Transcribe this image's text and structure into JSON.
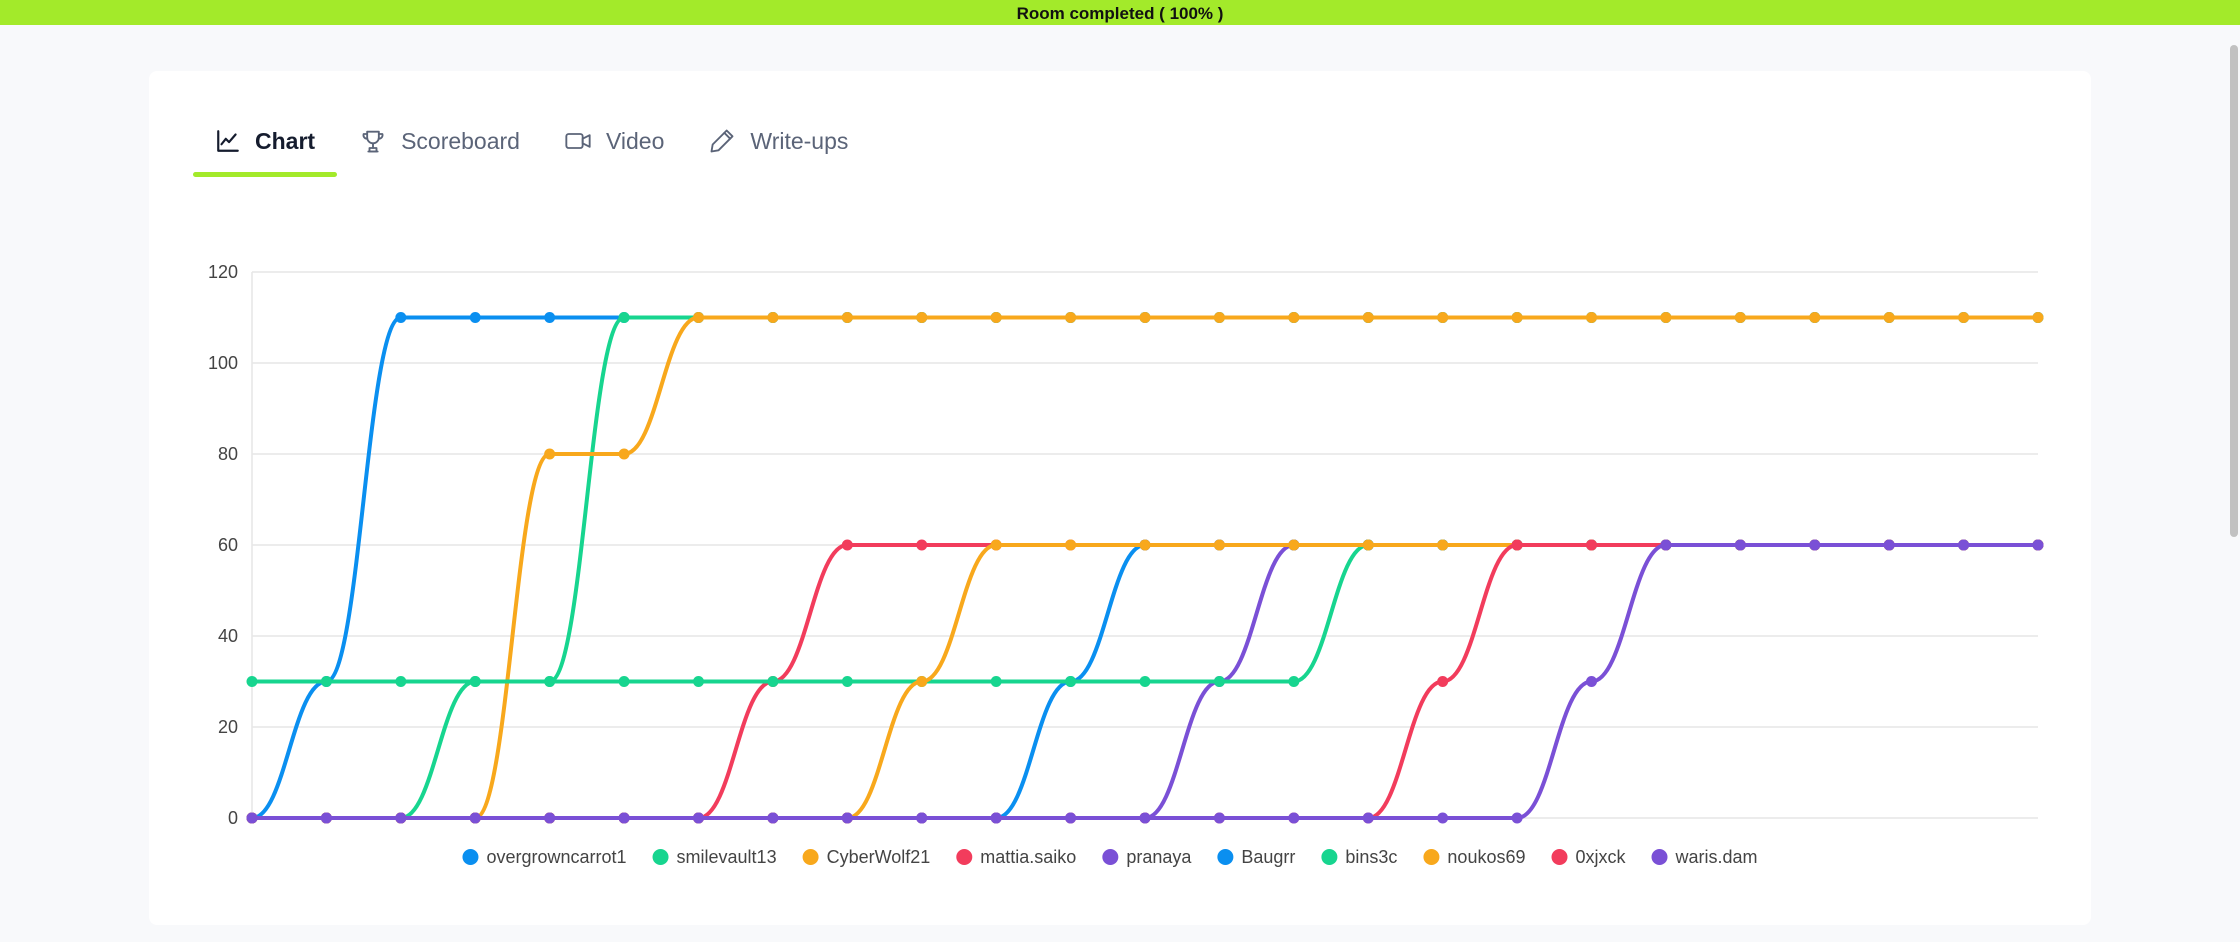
{
  "banner": {
    "text": "Room completed ( 100% )"
  },
  "tabs": [
    {
      "label": "Chart",
      "icon": "chart-line-icon",
      "active": true
    },
    {
      "label": "Scoreboard",
      "icon": "trophy-icon",
      "active": false
    },
    {
      "label": "Video",
      "icon": "video-camera-icon",
      "active": false
    },
    {
      "label": "Write-ups",
      "icon": "pencil-icon",
      "active": false
    }
  ],
  "chart_data": {
    "type": "line",
    "ylim": [
      0,
      120
    ],
    "yticks": [
      0,
      20,
      40,
      60,
      80,
      100,
      120
    ],
    "grid": true,
    "legend_position": "bottom",
    "x": [
      0,
      1,
      2,
      3,
      4,
      5,
      6,
      7,
      8,
      9,
      10,
      11,
      12,
      13,
      14,
      15,
      16,
      17,
      18,
      19,
      20,
      21,
      22,
      23,
      24
    ],
    "series": [
      {
        "name": "overgrowncarrot1",
        "color": "#0a8ff0",
        "values": [
          0,
          30,
          110,
          110,
          110,
          110,
          110,
          110,
          110,
          110,
          110,
          110,
          110,
          110,
          110,
          110,
          110,
          110,
          110,
          110,
          110,
          110,
          110,
          110,
          110
        ]
      },
      {
        "name": "smilevault13",
        "color": "#17d58f",
        "values": [
          0,
          0,
          0,
          30,
          30,
          110,
          110,
          110,
          110,
          110,
          110,
          110,
          110,
          110,
          110,
          110,
          110,
          110,
          110,
          110,
          110,
          110,
          110,
          110,
          110
        ]
      },
      {
        "name": "CyberWolf21",
        "color": "#f8a81c",
        "values": [
          0,
          0,
          0,
          0,
          80,
          80,
          110,
          110,
          110,
          110,
          110,
          110,
          110,
          110,
          110,
          110,
          110,
          110,
          110,
          110,
          110,
          110,
          110,
          110,
          110
        ]
      },
      {
        "name": "mattia.saiko",
        "color": "#f23c5c",
        "values": [
          0,
          0,
          0,
          0,
          0,
          0,
          0,
          30,
          60,
          60,
          60,
          60,
          60,
          60,
          60,
          60,
          60,
          60,
          60,
          60,
          60,
          60,
          60,
          60,
          60
        ]
      },
      {
        "name": "pranaya",
        "color": "#7a50d6",
        "values": [
          0,
          0,
          0,
          0,
          0,
          0,
          0,
          0,
          0,
          0,
          0,
          0,
          0,
          30,
          60,
          60,
          60,
          60,
          60,
          60,
          60,
          60,
          60,
          60,
          60
        ]
      },
      {
        "name": "Baugrr",
        "color": "#0a8ff0",
        "values": [
          0,
          0,
          0,
          0,
          0,
          0,
          0,
          0,
          0,
          0,
          0,
          30,
          60,
          60,
          60,
          60,
          60,
          60,
          60,
          60,
          60,
          60,
          60,
          60,
          60
        ]
      },
      {
        "name": "bins3c",
        "color": "#17d58f",
        "values": [
          30,
          30,
          30,
          30,
          30,
          30,
          30,
          30,
          30,
          30,
          30,
          30,
          30,
          30,
          30,
          60,
          60,
          60,
          60,
          60,
          60,
          60,
          60,
          60,
          60
        ]
      },
      {
        "name": "noukos69",
        "color": "#f8a81c",
        "values": [
          0,
          0,
          0,
          0,
          0,
          0,
          0,
          0,
          0,
          30,
          60,
          60,
          60,
          60,
          60,
          60,
          60,
          60,
          60,
          60,
          60,
          60,
          60,
          60,
          60
        ]
      },
      {
        "name": "0xjxck",
        "color": "#f23c5c",
        "values": [
          0,
          0,
          0,
          0,
          0,
          0,
          0,
          0,
          0,
          0,
          0,
          0,
          0,
          0,
          0,
          0,
          30,
          60,
          60,
          60,
          60,
          60,
          60,
          60,
          60
        ]
      },
      {
        "name": "waris.dam",
        "color": "#7a50d6",
        "values": [
          0,
          0,
          0,
          0,
          0,
          0,
          0,
          0,
          0,
          0,
          0,
          0,
          0,
          0,
          0,
          0,
          0,
          0,
          30,
          60,
          60,
          60,
          60,
          60,
          60
        ]
      }
    ]
  }
}
